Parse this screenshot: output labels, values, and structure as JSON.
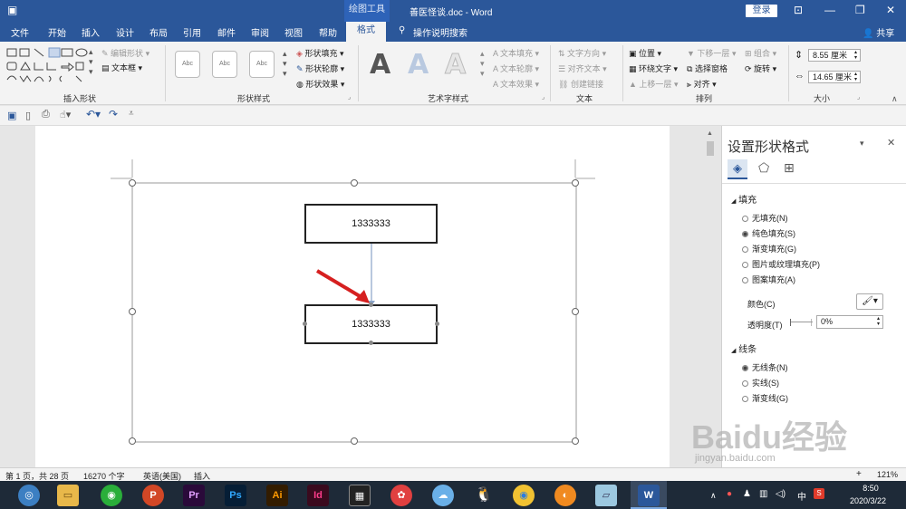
{
  "window": {
    "title": "善医怪谈.doc  -  Word",
    "context_group": "绘图工具",
    "login": "登录",
    "share": "共享"
  },
  "tabs": [
    "文件",
    "开始",
    "插入",
    "设计",
    "布局",
    "引用",
    "邮件",
    "审阅",
    "视图",
    "帮助"
  ],
  "active_tab": "格式",
  "tell_me": "操作说明搜索",
  "ribbon": {
    "insert_shapes": {
      "label": "插入形状",
      "edit_shape": "编辑形状",
      "textbox": "文本框"
    },
    "shape_styles": {
      "label": "形状样式",
      "style_text": "Abc",
      "fill": "形状填充",
      "outline": "形状轮廓",
      "effects": "形状效果"
    },
    "wordart": {
      "label": "艺术字样式",
      "letter": "A",
      "text_fill": "文本填充",
      "text_outline": "文本轮廓",
      "text_effects": "文本效果"
    },
    "text": {
      "label": "文本",
      "direction": "文字方向",
      "align": "对齐文本",
      "link": "创建链接"
    },
    "arrange": {
      "label": "排列",
      "position": "位置",
      "wrap": "环绕文字",
      "forward": "上移一层",
      "backward": "下移一层",
      "selection_pane": "选择窗格",
      "align": "对齐",
      "group": "组合",
      "rotate": "旋转"
    },
    "size": {
      "label": "大小",
      "height": "8.55 厘米",
      "width": "14.65 厘米"
    }
  },
  "canvas": {
    "box1_text": "1333333",
    "box2_text": "1333333"
  },
  "pane": {
    "title": "设置形状格式",
    "fill_section": "填充",
    "fill_options": [
      "无填充(N)",
      "纯色填充(S)",
      "渐变填充(G)",
      "图片或纹理填充(P)",
      "图案填充(A)"
    ],
    "fill_selected": 1,
    "color_label": "颜色(C)",
    "transparency_label": "透明度(T)",
    "transparency_value": "0%",
    "line_section": "线条",
    "line_options": [
      "无线条(N)",
      "实线(S)",
      "渐变线(G)"
    ],
    "line_selected": 0
  },
  "status": {
    "page": "第 1 页，共 28 页",
    "words": "16270 个字",
    "lang": "英语(美国)",
    "mode": "插入",
    "zoom": "121%"
  },
  "taskbar": {
    "time": "8:50",
    "date": "2020/3/22",
    "apps": [
      "Pr",
      "Ps",
      "Ai",
      "Id",
      "W"
    ],
    "tray_ime": "中"
  },
  "watermark": {
    "text": "Baidu经验",
    "url": "jingyan.baidu.com"
  }
}
